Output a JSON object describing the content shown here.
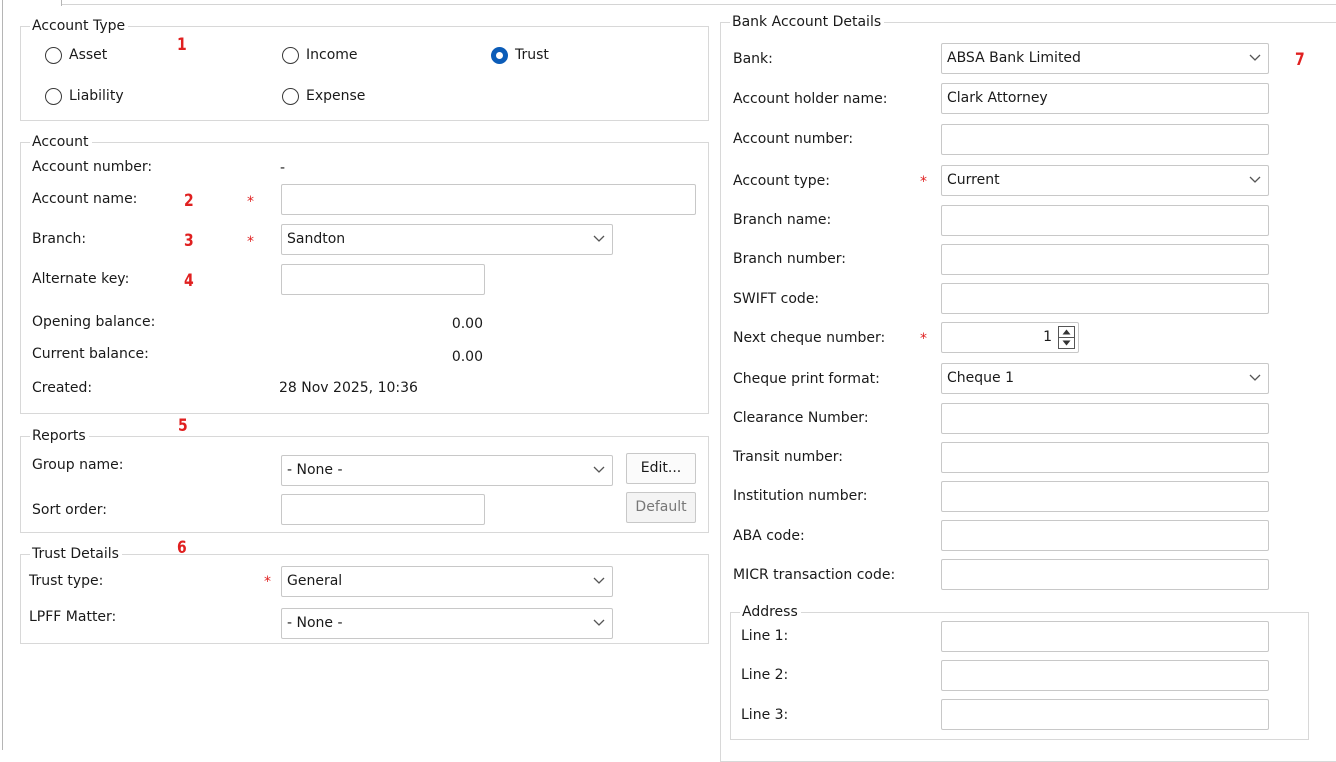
{
  "account_type": {
    "legend": "Account Type",
    "marker": "1",
    "options": [
      {
        "label": "Asset",
        "checked": false
      },
      {
        "label": "Income",
        "checked": false
      },
      {
        "label": "Trust",
        "checked": true
      },
      {
        "label": "Liability",
        "checked": false
      },
      {
        "label": "Expense",
        "checked": false
      }
    ]
  },
  "account": {
    "legend": "Account",
    "account_number_label": "Account number:",
    "account_number_value": "-",
    "account_name_label": "Account name:",
    "account_name_marker": "2",
    "account_name_value": "",
    "branch_label": "Branch:",
    "branch_marker": "3",
    "branch_value": "Sandton",
    "alternate_key_label": "Alternate key:",
    "alternate_key_marker": "4",
    "alternate_key_value": "",
    "opening_balance_label": "Opening balance:",
    "opening_balance_value": "0.00",
    "current_balance_label": "Current balance:",
    "current_balance_value": "0.00",
    "created_label": "Created:",
    "created_value": "28 Nov 2025, 10:36"
  },
  "reports": {
    "legend": "Reports",
    "marker": "5",
    "group_name_label": "Group name:",
    "group_name_value": "- None -",
    "edit_button": "Edit...",
    "sort_order_label": "Sort order:",
    "sort_order_value": "",
    "default_button": "Default"
  },
  "trust_details": {
    "legend": "Trust Details",
    "marker": "6",
    "trust_type_label": "Trust type:",
    "trust_type_value": "General",
    "lpff_label": "LPFF Matter:",
    "lpff_value": "- None -"
  },
  "bank": {
    "legend": "Bank Account Details",
    "marker": "7",
    "bank_label": "Bank:",
    "bank_value": "ABSA Bank Limited",
    "holder_label": "Account holder name:",
    "holder_value": "Clark Attorney",
    "account_number_label": "Account number:",
    "account_number_value": "",
    "account_type_label": "Account type:",
    "account_type_value": "Current",
    "branch_name_label": "Branch name:",
    "branch_name_value": "",
    "branch_number_label": "Branch number:",
    "branch_number_value": "",
    "swift_label": "SWIFT code:",
    "swift_value": "",
    "next_cheque_label": "Next cheque number:",
    "next_cheque_value": "1",
    "cheque_format_label": "Cheque print format:",
    "cheque_format_value": "Cheque 1",
    "clearance_label": "Clearance Number:",
    "clearance_value": "",
    "transit_label": "Transit number:",
    "transit_value": "",
    "institution_label": "Institution number:",
    "institution_value": "",
    "aba_label": "ABA code:",
    "aba_value": "",
    "micr_label": "MICR transaction code:",
    "micr_value": "",
    "address": {
      "legend": "Address",
      "line1_label": "Line 1:",
      "line1_value": "",
      "line2_label": "Line 2:",
      "line2_value": "",
      "line3_label": "Line 3:",
      "line3_value": ""
    }
  },
  "required_mark": "*",
  "colors": {
    "accent": "#0b5cb8",
    "required": "#e02020",
    "border": "#c8c8c8"
  }
}
